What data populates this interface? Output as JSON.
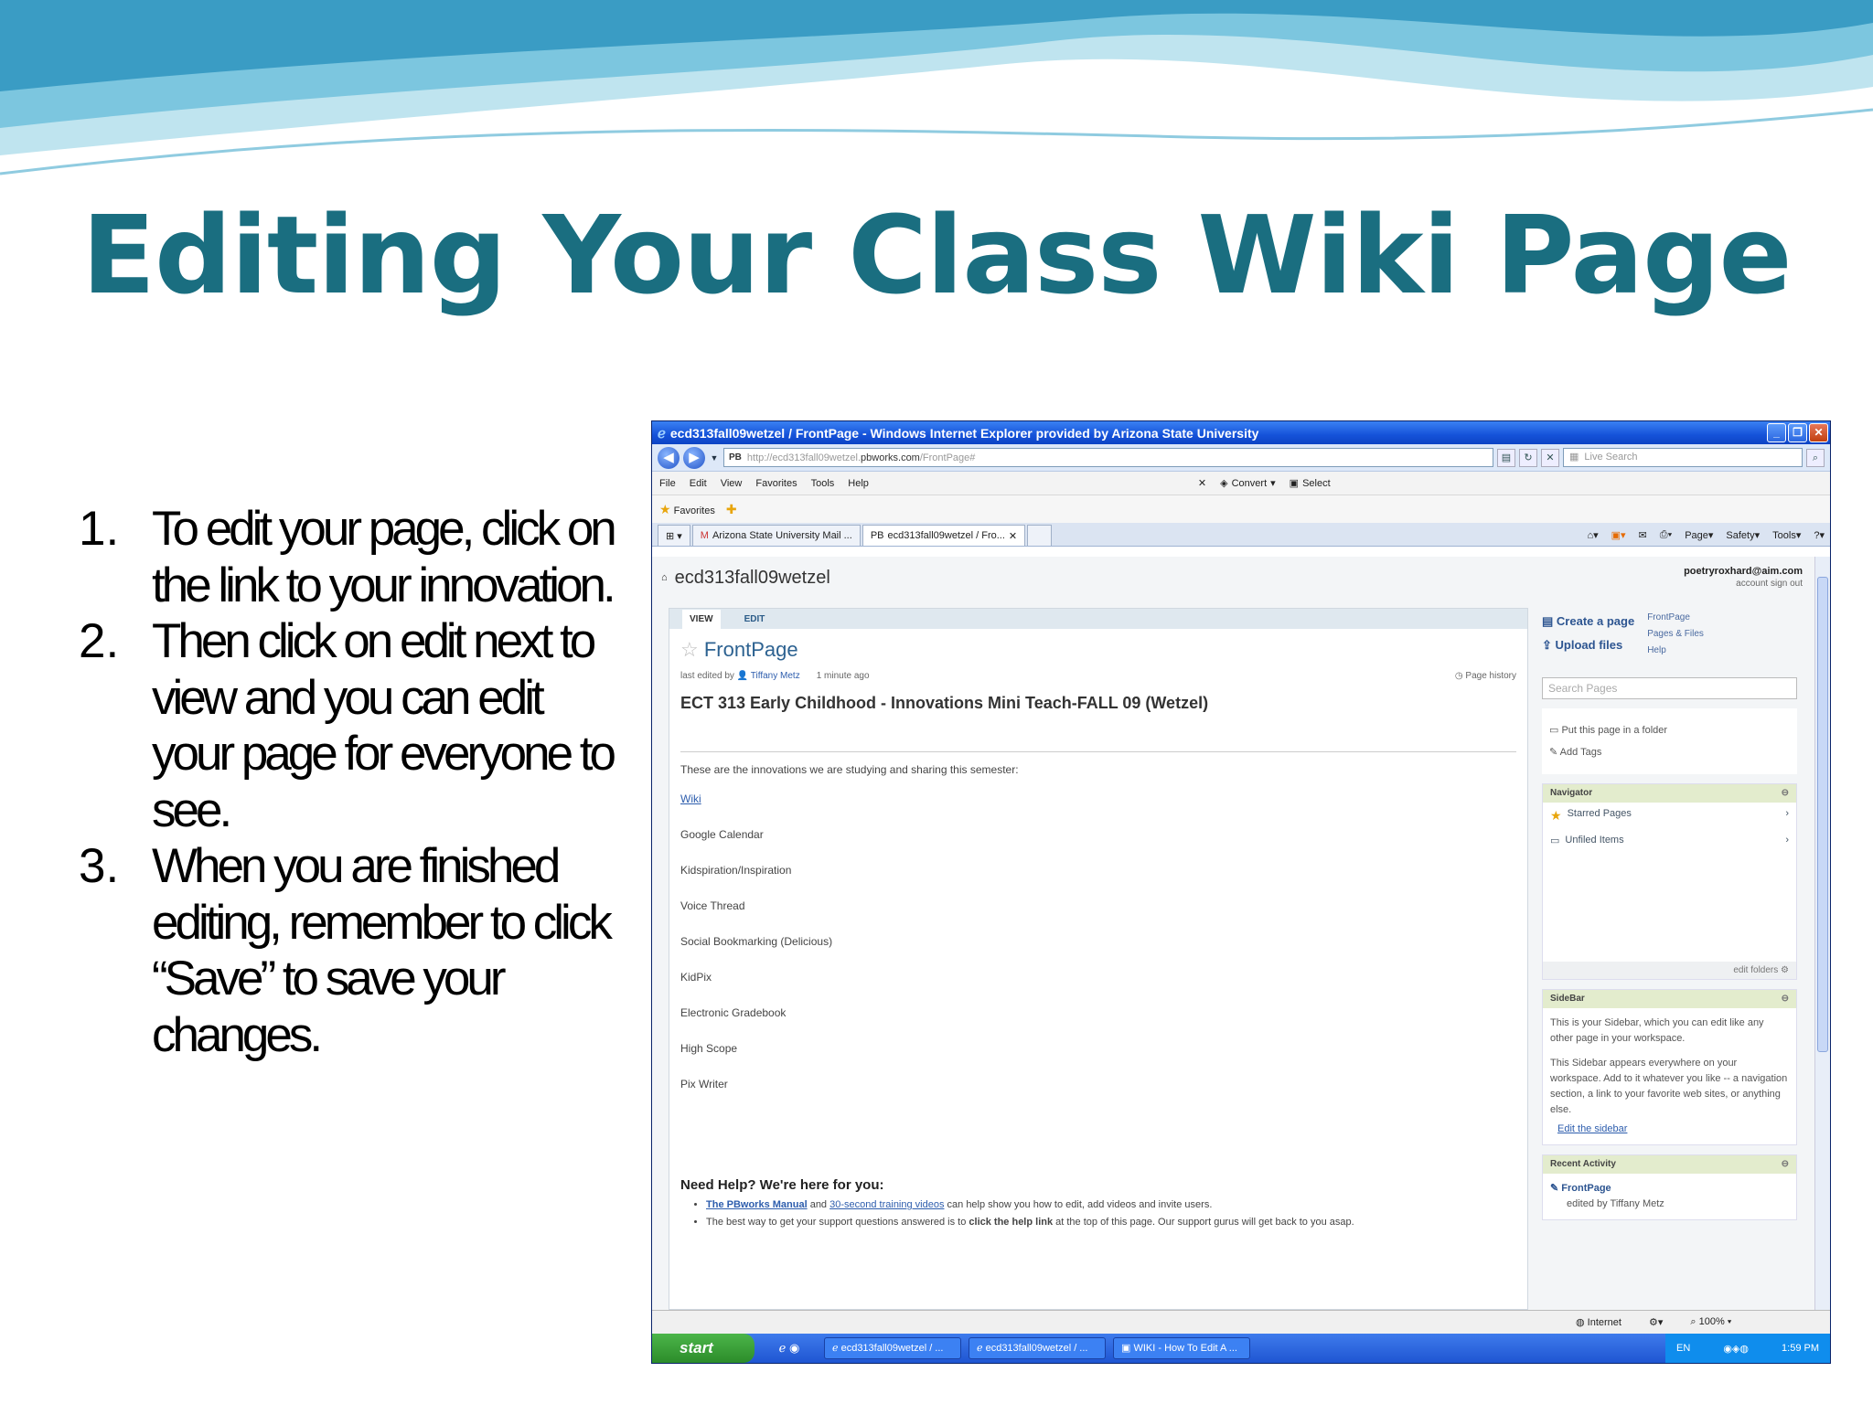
{
  "slide": {
    "title": "Editing Your Class Wiki Page",
    "steps": [
      {
        "num": "1.",
        "text": "To edit your page, click on the link to your innovation."
      },
      {
        "num": "2.",
        "text": "Then click on edit next to view and you can edit your page for everyone to see."
      },
      {
        "num": "3.",
        "text": "When you are finished editing, remember to click “Save” to save your changes."
      }
    ]
  },
  "browser": {
    "window_title": "ecd313fall09wetzel / FrontPage - Windows Internet Explorer provided by Arizona State University",
    "url_prefix": "http://ecd313fall09wetzel.",
    "url_domain": "pbworks.com",
    "url_suffix": "/FrontPage#",
    "search_placeholder": "Live Search",
    "menu": [
      "File",
      "Edit",
      "View",
      "Favorites",
      "Tools",
      "Help"
    ],
    "convert_label": "Convert",
    "select_label": "Select",
    "favorites_label": "Favorites",
    "tabs": [
      "Arizona State University Mail ...",
      "ecd313fall09wetzel / Fro..."
    ],
    "right_tools": [
      "Page",
      "Safety",
      "Tools"
    ],
    "status_zone": "Internet",
    "zoom": "100%"
  },
  "wiki": {
    "workspace": "ecd313fall09wetzel",
    "user": "poetryroxhard@aim.com",
    "user_links": "account  sign out",
    "tabs": {
      "view": "VIEW",
      "edit": "EDIT"
    },
    "page_title": "FrontPage",
    "last_edited": "last edited by",
    "editor": "Tiffany Metz",
    "edited_when": "1 minute ago",
    "page_history": "Page history",
    "heading": "ECT 313 Early Childhood - Innovations Mini Teach-FALL 09 (Wetzel)",
    "intro": "These are the innovations we are studying and sharing this semester:",
    "innovations": [
      "Wiki",
      "Google Calendar",
      "Kidspiration/Inspiration",
      "Voice Thread",
      "Social Bookmarking (Delicious)",
      "KidPix",
      "Electronic Gradebook",
      "High Scope",
      "Pix Writer"
    ],
    "help_heading": "Need Help? We're here for you:",
    "help_manual": "The PBworks Manual",
    "help_and": " and ",
    "help_videos": "30-second training videos",
    "help_rest1": " can help show you how to edit, add videos and invite users.",
    "help_line2_a": "The best way to get your support questions answered is to ",
    "help_line2_b": "click the help link",
    "help_line2_c": " at the top of this page.  Our support gurus will get back to you asap.",
    "create_page": "Create a page",
    "upload_files": "Upload files",
    "side_links": [
      "FrontPage",
      "Pages & Files",
      "Help"
    ],
    "search_pages": "Search Pages",
    "put_in_folder": "Put this page in a folder",
    "add_tags": "Add Tags",
    "navigator": "Navigator",
    "starred_pages": "Starred Pages",
    "unfiled_items": "Unfiled Items",
    "edit_folders": "edit folders",
    "sidebar_h": "SideBar",
    "sidebar_p1": "This is your Sidebar, which you can edit like any other page in your workspace.",
    "sidebar_p2": "This Sidebar appears everywhere on your workspace. Add to it whatever you like -- a navigation section, a link to your favorite web sites, or anything else.",
    "edit_sidebar": "Edit the sidebar",
    "recent_h": "Recent Activity",
    "recent_page": "FrontPage",
    "recent_by": "edited by Tiffany Metz"
  },
  "taskbar": {
    "start": "start",
    "tasks": [
      "ecd313fall09wetzel / ...",
      "ecd313fall09wetzel / ...",
      "WIKI - How To Edit A ..."
    ],
    "lang": "EN",
    "time": "1:59 PM"
  }
}
